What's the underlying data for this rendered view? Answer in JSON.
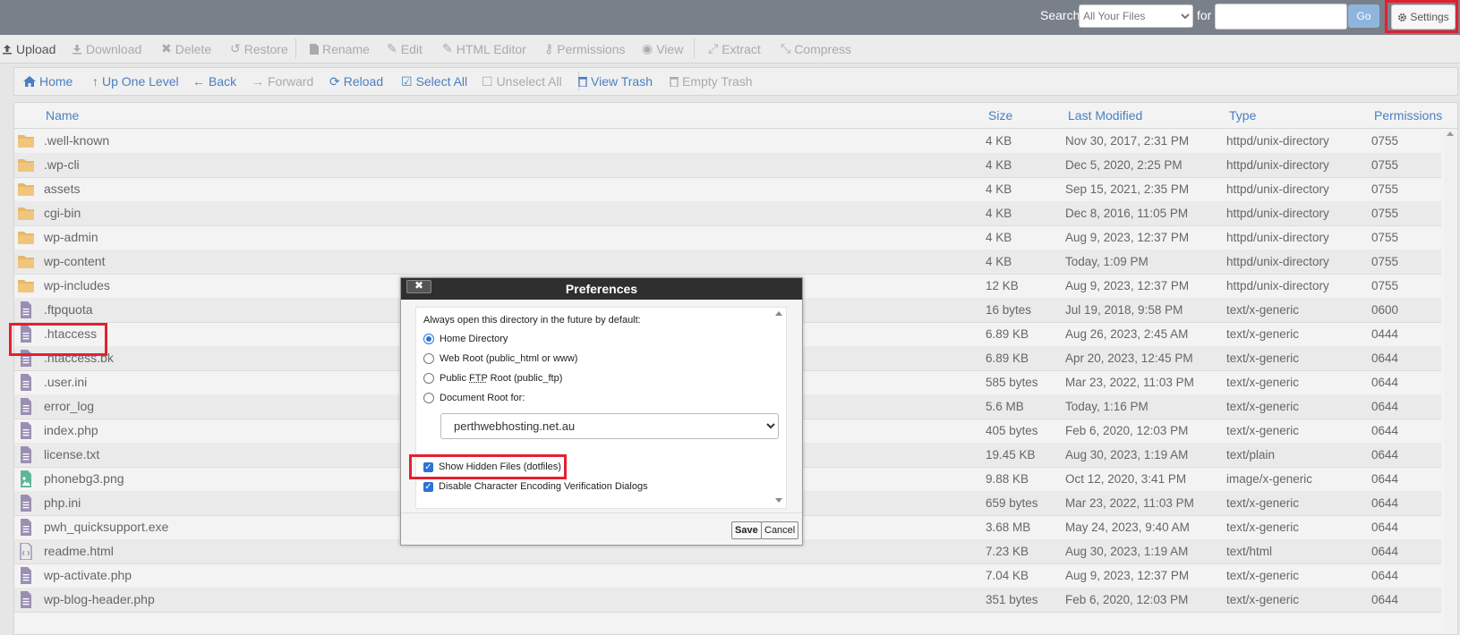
{
  "topbar": {
    "search_label": "Search",
    "search_scope": "All Your Files",
    "for_label": "for",
    "query_value": "",
    "go_label": "Go",
    "settings_label": "Settings"
  },
  "toolbar": [
    {
      "label": "Upload",
      "icon": "upload-icon",
      "enabled": true
    },
    {
      "label": "Download",
      "icon": "download-icon",
      "enabled": false
    },
    {
      "label": "Delete",
      "icon": "close-icon",
      "enabled": false
    },
    {
      "label": "Restore",
      "icon": "restore-icon",
      "enabled": false
    },
    {
      "label": "Rename",
      "icon": "file-icon",
      "enabled": false
    },
    {
      "label": "Edit",
      "icon": "pencil-icon",
      "enabled": false
    },
    {
      "label": "HTML Editor",
      "icon": "html-editor-icon",
      "enabled": false
    },
    {
      "label": "Permissions",
      "icon": "key-icon",
      "enabled": false
    },
    {
      "label": "View",
      "icon": "eye-icon",
      "enabled": false
    },
    {
      "label": "Extract",
      "icon": "expand-icon",
      "enabled": false
    },
    {
      "label": "Compress",
      "icon": "compress-icon",
      "enabled": false
    }
  ],
  "navbar": [
    {
      "label": "Home",
      "icon": "home-icon",
      "enabled": true
    },
    {
      "label": "Up One Level",
      "icon": "up-arrow-icon",
      "enabled": true
    },
    {
      "label": "Back",
      "icon": "left-arrow-icon",
      "enabled": true
    },
    {
      "label": "Forward",
      "icon": "right-arrow-icon",
      "enabled": false
    },
    {
      "label": "Reload",
      "icon": "reload-icon",
      "enabled": true
    },
    {
      "label": "Select All",
      "icon": "checkbox-checked-icon",
      "enabled": true
    },
    {
      "label": "Unselect All",
      "icon": "checkbox-empty-icon",
      "enabled": false
    },
    {
      "label": "View Trash",
      "icon": "trash-icon",
      "enabled": true
    },
    {
      "label": "Empty Trash",
      "icon": "trash-icon",
      "enabled": false
    }
  ],
  "table": {
    "headers": {
      "name": "Name",
      "size": "Size",
      "modified": "Last Modified",
      "type": "Type",
      "perms": "Permissions"
    },
    "rows": [
      {
        "icon": "folder-icon",
        "name": ".well-known",
        "size": "4 KB",
        "modified": "Nov 30, 2017, 2:31 PM",
        "type": "httpd/unix-directory",
        "perms": "0755"
      },
      {
        "icon": "folder-icon",
        "name": ".wp-cli",
        "size": "4 KB",
        "modified": "Dec 5, 2020, 2:25 PM",
        "type": "httpd/unix-directory",
        "perms": "0755"
      },
      {
        "icon": "folder-icon",
        "name": "assets",
        "size": "4 KB",
        "modified": "Sep 15, 2021, 2:35 PM",
        "type": "httpd/unix-directory",
        "perms": "0755"
      },
      {
        "icon": "folder-icon",
        "name": "cgi-bin",
        "size": "4 KB",
        "modified": "Dec 8, 2016, 11:05 PM",
        "type": "httpd/unix-directory",
        "perms": "0755"
      },
      {
        "icon": "folder-icon",
        "name": "wp-admin",
        "size": "4 KB",
        "modified": "Aug 9, 2023, 12:37 PM",
        "type": "httpd/unix-directory",
        "perms": "0755"
      },
      {
        "icon": "folder-icon",
        "name": "wp-content",
        "size": "4 KB",
        "modified": "Today, 1:09 PM",
        "type": "httpd/unix-directory",
        "perms": "0755"
      },
      {
        "icon": "folder-icon",
        "name": "wp-includes",
        "size": "12 KB",
        "modified": "Aug 9, 2023, 12:37 PM",
        "type": "httpd/unix-directory",
        "perms": "0755"
      },
      {
        "icon": "file-icon",
        "name": ".ftpquota",
        "size": "16 bytes",
        "modified": "Jul 19, 2018, 9:58 PM",
        "type": "text/x-generic",
        "perms": "0600"
      },
      {
        "icon": "file-icon",
        "name": ".htaccess",
        "size": "6.89 KB",
        "modified": "Aug 26, 2023, 2:45 AM",
        "type": "text/x-generic",
        "perms": "0444"
      },
      {
        "icon": "file-icon",
        "name": ".htaccess.bk",
        "size": "6.89 KB",
        "modified": "Apr 20, 2023, 12:45 PM",
        "type": "text/x-generic",
        "perms": "0644"
      },
      {
        "icon": "file-icon",
        "name": ".user.ini",
        "size": "585 bytes",
        "modified": "Mar 23, 2022, 11:03 PM",
        "type": "text/x-generic",
        "perms": "0644"
      },
      {
        "icon": "file-icon",
        "name": "error_log",
        "size": "5.6 MB",
        "modified": "Today, 1:16 PM",
        "type": "text/x-generic",
        "perms": "0644"
      },
      {
        "icon": "file-icon",
        "name": "index.php",
        "size": "405 bytes",
        "modified": "Feb 6, 2020, 12:03 PM",
        "type": "text/x-generic",
        "perms": "0644"
      },
      {
        "icon": "file-icon",
        "name": "license.txt",
        "size": "19.45 KB",
        "modified": "Aug 30, 2023, 1:19 AM",
        "type": "text/plain",
        "perms": "0644"
      },
      {
        "icon": "image-file-icon",
        "name": "phonebg3.png",
        "size": "9.88 KB",
        "modified": "Oct 12, 2020, 3:41 PM",
        "type": "image/x-generic",
        "perms": "0644"
      },
      {
        "icon": "file-icon",
        "name": "php.ini",
        "size": "659 bytes",
        "modified": "Mar 23, 2022, 11:03 PM",
        "type": "text/x-generic",
        "perms": "0644"
      },
      {
        "icon": "file-icon",
        "name": "pwh_quicksupport.exe",
        "size": "3.68 MB",
        "modified": "May 24, 2023, 9:40 AM",
        "type": "text/x-generic",
        "perms": "0644"
      },
      {
        "icon": "html-file-icon",
        "name": "readme.html",
        "size": "7.23 KB",
        "modified": "Aug 30, 2023, 1:19 AM",
        "type": "text/html",
        "perms": "0644"
      },
      {
        "icon": "file-icon",
        "name": "wp-activate.php",
        "size": "7.04 KB",
        "modified": "Aug 9, 2023, 12:37 PM",
        "type": "text/x-generic",
        "perms": "0644"
      },
      {
        "icon": "file-icon",
        "name": "wp-blog-header.php",
        "size": "351 bytes",
        "modified": "Feb 6, 2020, 12:03 PM",
        "type": "text/x-generic",
        "perms": "0644"
      }
    ]
  },
  "dialog": {
    "title": "Preferences",
    "close_label": "✖",
    "intro": "Always open this directory in the future by default:",
    "options": {
      "home": "Home Directory",
      "webroot": "Web Root (public_html or www)",
      "ftp_prefix": "Public ",
      "ftp_abbr": "FTP",
      "ftp_suffix": " Root (public_ftp)",
      "docroot": "Document Root for:"
    },
    "selected_option": "home",
    "docroot_domain": "perthwebhosting.net.au",
    "show_hidden_label": "Show Hidden Files (dotfiles)",
    "show_hidden_checked": true,
    "disable_encoding_label": "Disable Character Encoding Verification Dialogs",
    "disable_encoding_checked": true,
    "save_label": "Save",
    "cancel_label": "Cancel"
  },
  "colors": {
    "highlight": "#e5202e",
    "link": "#4a7fc0",
    "folder": "#e8b86a",
    "file": "#9a8fb3",
    "topbar": "#7a8089"
  }
}
